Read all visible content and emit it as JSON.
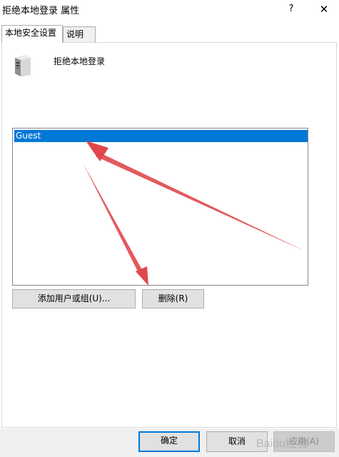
{
  "window": {
    "title": "拒绝本地登录 属性",
    "help_glyph": "?",
    "close_glyph": "✕"
  },
  "tabs": [
    {
      "label": "本地安全设置",
      "active": true
    },
    {
      "label": "说明",
      "active": false
    }
  ],
  "policy": {
    "icon": "server-icon",
    "name": "拒绝本地登录"
  },
  "accounts": {
    "items": [
      {
        "label": "Guest",
        "selected": true
      }
    ]
  },
  "actions": {
    "add_label": "添加用户或组(U)...",
    "remove_label": "删除(R)"
  },
  "footer": {
    "ok_label": "确定",
    "cancel_label": "取消",
    "apply_label": "应用(A)"
  },
  "watermark": {
    "text": "Baidu经验"
  },
  "colors": {
    "selection": "#0078d7",
    "arrow": "#e0474c"
  }
}
